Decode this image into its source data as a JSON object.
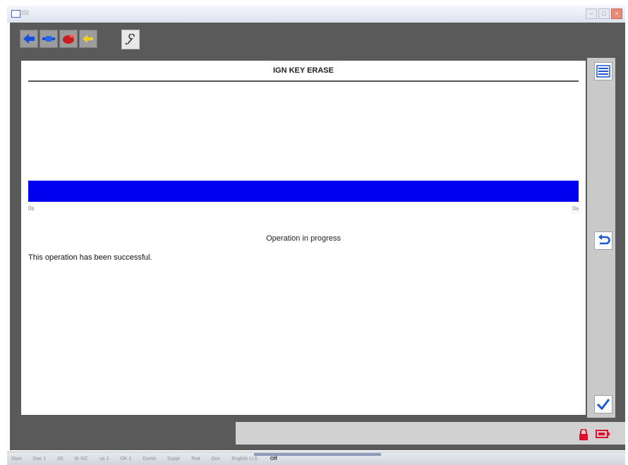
{
  "window": {
    "title": "ISI"
  },
  "panel": {
    "title": "IGN KEY ERASE"
  },
  "progress": {
    "value_percent": 100,
    "min_label": "0s",
    "max_label": "0s",
    "color": "#0000f0"
  },
  "status": {
    "heading": "Operation in progress",
    "message": "This operation has been successful."
  },
  "toolbar": {
    "buttons": [
      {
        "icon": "arrow-left-icon"
      },
      {
        "icon": "connector-icon"
      },
      {
        "icon": "vehicle-plug-icon"
      },
      {
        "icon": "yellow-arrow-icon"
      },
      {
        "icon": "wrench-icon"
      }
    ]
  },
  "side_actions": [
    {
      "icon": "list-icon"
    },
    {
      "icon": "return-icon"
    },
    {
      "icon": "checkmark-icon"
    }
  ],
  "status_indicators": [
    {
      "icon": "lock-icon",
      "color": "#e0102a"
    },
    {
      "icon": "battery-icon",
      "color": "#e0102a"
    }
  ],
  "taskbar": {
    "items": [
      "Start",
      "Doc 1",
      "ISI",
      "IK 5/C",
      "us 1",
      "OK 1",
      "Dumb",
      "Suppl",
      "Test",
      "Doc",
      "English U.S.",
      "Off"
    ]
  }
}
